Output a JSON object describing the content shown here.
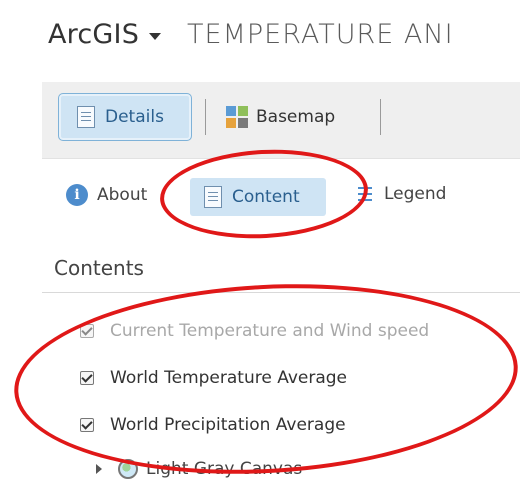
{
  "header": {
    "app_name": "ArcGIS",
    "map_title": "TEMPERATURE ANI"
  },
  "toolbar": {
    "details_label": "Details",
    "basemap_label": "Basemap"
  },
  "tabs": {
    "about_label": "About",
    "content_label": "Content",
    "legend_label": "Legend"
  },
  "contents": {
    "heading": "Contents",
    "layers": [
      {
        "label": "Current Temperature and Wind speed",
        "checked": true,
        "faded": true
      },
      {
        "label": "World Temperature Average",
        "checked": true,
        "faded": false
      },
      {
        "label": "World Precipitation Average",
        "checked": true,
        "faded": false
      }
    ],
    "basemap_item": "Light Gray Canvas"
  },
  "colors": {
    "accent": "#4d8ccc",
    "selected_bg": "#cfe4f4",
    "annotation": "#e01818"
  },
  "icons": [
    "chevron-down-icon",
    "document-icon",
    "basemap-grid-icon",
    "info-icon",
    "legend-icon",
    "checkbox-icon",
    "expand-triangle-icon",
    "globe-icon"
  ]
}
